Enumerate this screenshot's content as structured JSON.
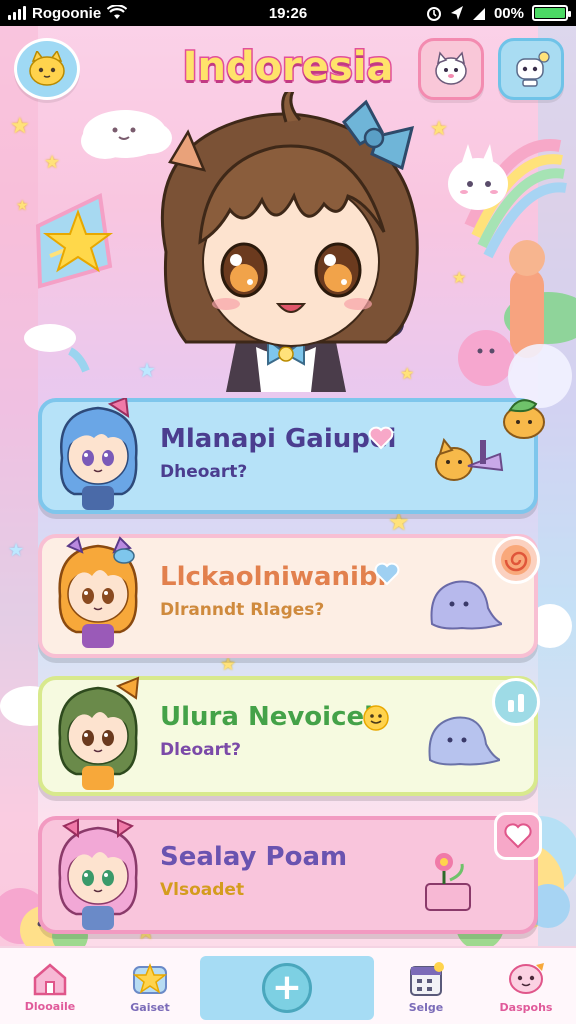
{
  "status_bar": {
    "carrier": "Rogoonie",
    "time": "19:26",
    "battery": "00%",
    "battery_level": 1.0
  },
  "header": {
    "title": "Indoresia",
    "profile_icon": "cat-face-icon",
    "pet_icon": "pet-face-icon",
    "robot_icon": "robot-icon"
  },
  "characters": [
    {
      "name": "Mlanapi Gaiupei",
      "subtitle": "Dheoart?",
      "badge_icon": "heart-icon",
      "accent": "#7ec6ec"
    },
    {
      "name": "Llckaolniwanibi",
      "subtitle": "Dlranndt Rlages?",
      "badge_icon": "heart-icon",
      "accent": "#f8bfd3"
    },
    {
      "name": "Ulura Nevoicel",
      "subtitle": "Dleoart?",
      "badge_icon": "smiley-icon",
      "accent": "#d8e98d"
    },
    {
      "name": "Sealay Poam",
      "subtitle": "Vlsoadet",
      "badge_icon": "none",
      "accent": "#f29ac1"
    }
  ],
  "bottom_nav": {
    "items": [
      {
        "label": "Dlooaile",
        "icon": "home-icon",
        "color": "#e05a9a"
      },
      {
        "label": "Gaiset",
        "icon": "star-icon",
        "color": "#7b6bb8"
      },
      {
        "label": "Selge",
        "icon": "calendar-icon",
        "color": "#7b6bb8"
      },
      {
        "label": "Daspohs",
        "icon": "character-icon",
        "color": "#e05a9a"
      }
    ],
    "add_icon": "plus-icon"
  }
}
